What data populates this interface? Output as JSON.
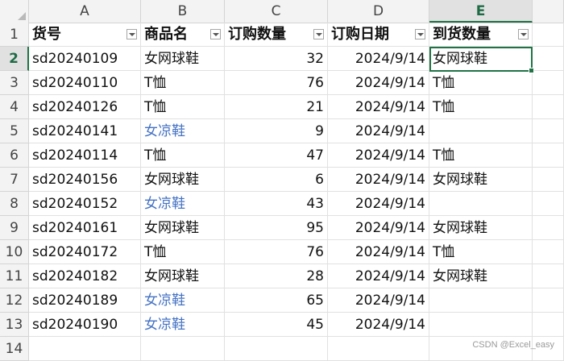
{
  "columns": [
    "A",
    "B",
    "C",
    "D",
    "E"
  ],
  "selected_column": "E",
  "headers": [
    "货号",
    "商品名",
    "订购数量",
    "订购日期",
    "到货数量"
  ],
  "rows": [
    {
      "num": "2",
      "a": "sd20240109",
      "b": "女网球鞋",
      "c": "32",
      "d": "2024/9/14",
      "e": "女网球鞋"
    },
    {
      "num": "3",
      "a": "sd20240110",
      "b": "T恤",
      "c": "76",
      "d": "2024/9/14",
      "e": "T恤"
    },
    {
      "num": "4",
      "a": "sd20240126",
      "b": "T恤",
      "c": "21",
      "d": "2024/9/14",
      "e": "T恤"
    },
    {
      "num": "5",
      "a": "sd20240141",
      "b": "女凉鞋",
      "c": "9",
      "d": "2024/9/14",
      "e": ""
    },
    {
      "num": "6",
      "a": "sd20240114",
      "b": "T恤",
      "c": "47",
      "d": "2024/9/14",
      "e": "T恤"
    },
    {
      "num": "7",
      "a": "sd20240156",
      "b": "女网球鞋",
      "c": "6",
      "d": "2024/9/14",
      "e": "女网球鞋"
    },
    {
      "num": "8",
      "a": "sd20240152",
      "b": "女凉鞋",
      "c": "43",
      "d": "2024/9/14",
      "e": ""
    },
    {
      "num": "9",
      "a": "sd20240161",
      "b": "女网球鞋",
      "c": "95",
      "d": "2024/9/14",
      "e": "女网球鞋"
    },
    {
      "num": "10",
      "a": "sd20240172",
      "b": "T恤",
      "c": "76",
      "d": "2024/9/14",
      "e": "T恤"
    },
    {
      "num": "11",
      "a": "sd20240182",
      "b": "女网球鞋",
      "c": "28",
      "d": "2024/9/14",
      "e": "女网球鞋"
    },
    {
      "num": "12",
      "a": "sd20240189",
      "b": "女凉鞋",
      "c": "65",
      "d": "2024/9/14",
      "e": ""
    },
    {
      "num": "13",
      "a": "sd20240190",
      "b": "女凉鞋",
      "c": "45",
      "d": "2024/9/14",
      "e": ""
    }
  ],
  "header_row_num": "1",
  "empty_row_num": "14",
  "highlighted_product": "女凉鞋",
  "colors": {
    "accent": "#217346",
    "highlight_text": "#4472c4"
  },
  "watermark": "CSDN @Excel_easy"
}
